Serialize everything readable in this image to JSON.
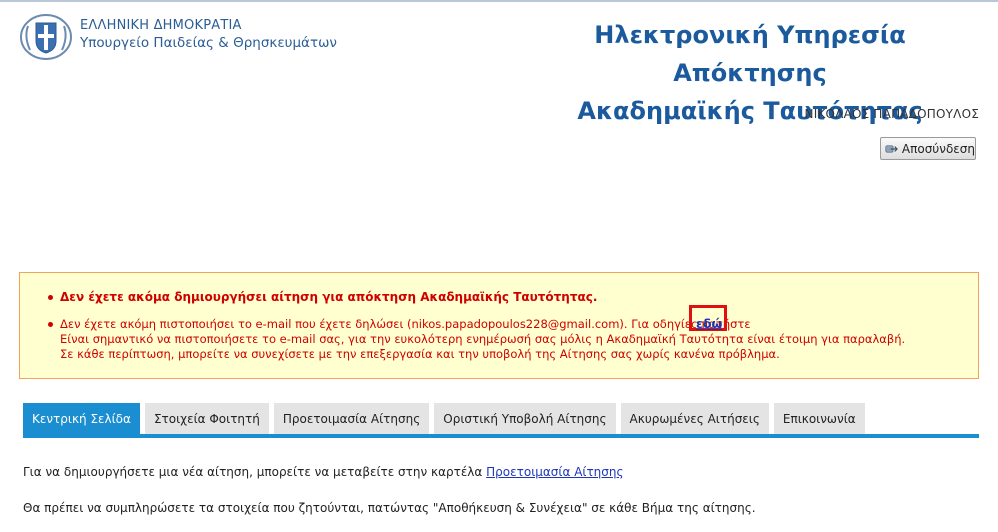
{
  "header": {
    "ministry_line1": "ΕΛΛΗΝΙΚΗ ΔΗΜΟΚΡΑΤΙΑ",
    "ministry_line2": "Υπουργείο Παιδείας & Θρησκευμάτων",
    "service_title_line1": "Ηλεκτρονική Υπηρεσία Απόκτησης",
    "service_title_line2": "Ακαδημαϊκής Ταυτότητας"
  },
  "user": {
    "name": "ΝΙΚΟΛΑΟΣ ΠΑΠΑΔΟΠΟΥΛΟΣ",
    "logout_label": "Αποσύνδεση"
  },
  "alert": {
    "message1": "Δεν έχετε ακόμα δημιουργήσει αίτηση για απόκτηση Ακαδημαϊκής Ταυτότητας.",
    "message2_line1": "Δεν έχετε ακόμη πιστοποιήσει το e-mail που έχετε δηλώσει (nikos.papadopoulos228@gmail.com). Για οδηγίες πατήστε",
    "link_label": "εδώ",
    "message2_line2": "Είναι σημαντικό να πιστοποιήσετε το e-mail σας, για την ευκολότερη ενημέρωσή σας μόλις η Ακαδημαϊκή Ταυτότητα είναι έτοιμη για παραλαβή.",
    "message2_line3": "Σε κάθε περίπτωση, μπορείτε να συνεχίσετε με την επεξεργασία και την υποβολή της Αίτησης σας χωρίς κανένα πρόβλημα."
  },
  "tabs": [
    {
      "label": "Κεντρική Σελίδα",
      "active": true
    },
    {
      "label": "Στοιχεία Φοιτητή"
    },
    {
      "label": "Προετοιμασία Αίτησης"
    },
    {
      "label": "Οριστική Υποβολή Αίτησης"
    },
    {
      "label": "Ακυρωμένες Αιτήσεις"
    },
    {
      "label": "Επικοινωνία"
    }
  ],
  "content": {
    "para1_text": "Για να δημιουργήσετε μια νέα αίτηση, μπορείτε να μεταβείτε στην καρτέλα",
    "para1_link": "Προετοιμασία Αίτησης",
    "para2_text": "Θα πρέπει να συμπληρώσετε τα στοιχεία που ζητούνται, πατώντας \"Αποθήκευση & Συνέχεια\" σε κάθε Βήμα της αίτησης."
  },
  "colors": {
    "accent": "#1b8ed1",
    "title_blue": "#1b5a9c",
    "alert_red": "#d10000",
    "alert_bg": "#ffffcf"
  },
  "icons": {
    "logo": "greek-coat-of-arms-icon",
    "logout": "logout-icon"
  }
}
